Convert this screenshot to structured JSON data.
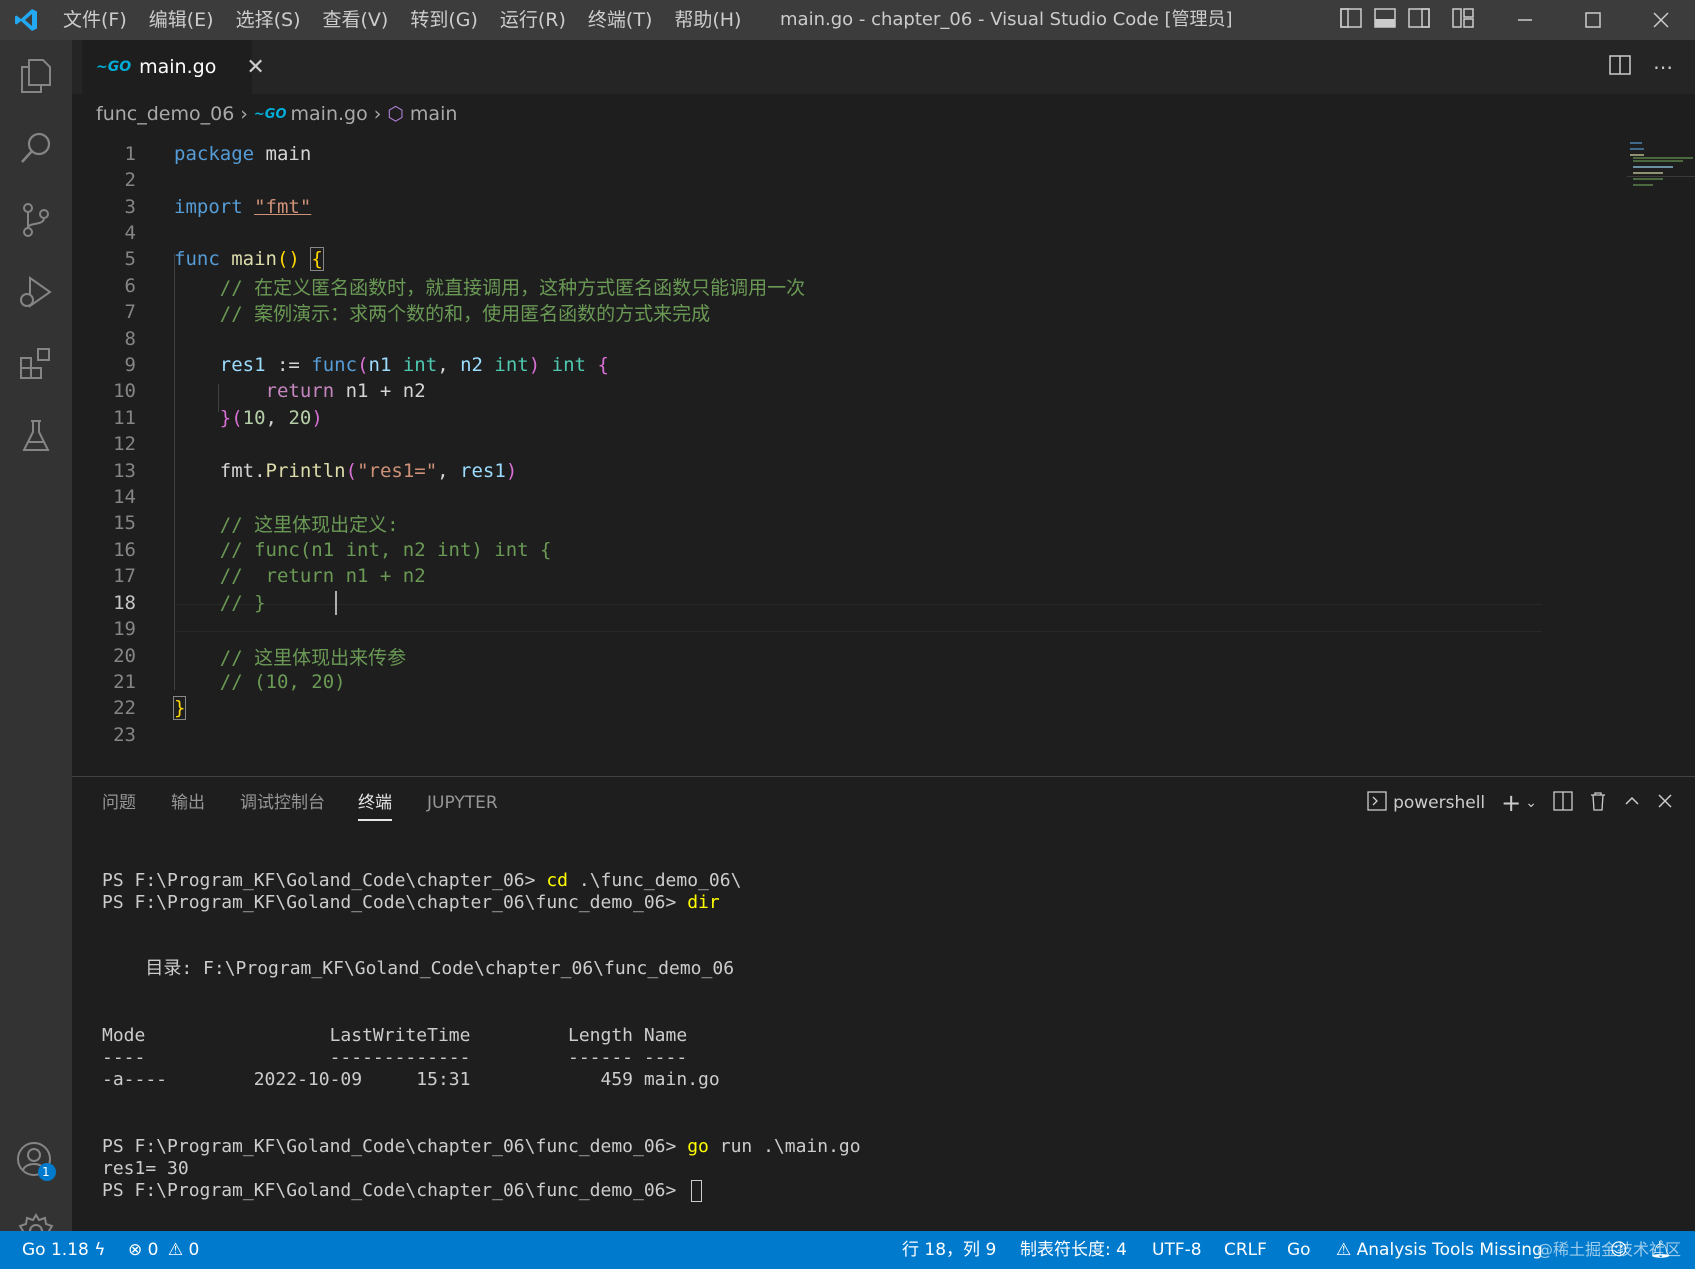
{
  "titlebar": {
    "menu": [
      "文件(F)",
      "编辑(E)",
      "选择(S)",
      "查看(V)",
      "转到(G)",
      "运行(R)",
      "终端(T)",
      "帮助(H)"
    ],
    "title": "main.go - chapter_06 - Visual Studio Code [管理员]"
  },
  "icons": {
    "activity": [
      "explorer-icon",
      "search-icon",
      "source-control-icon",
      "run-debug-icon",
      "extensions-icon",
      "testing-icon",
      "accounts-icon",
      "settings-gear-icon"
    ],
    "accounts_badge": "1"
  },
  "tab": {
    "label": "main.go",
    "close": "✕"
  },
  "breadcrumb": {
    "folder": "func_demo_06",
    "file": "main.go",
    "symbol": "main"
  },
  "editor": {
    "active_line": 18,
    "lines": [
      {
        "n": "1"
      },
      {
        "n": "2"
      },
      {
        "n": "3"
      },
      {
        "n": "4"
      },
      {
        "n": "5"
      },
      {
        "n": "6"
      },
      {
        "n": "7"
      },
      {
        "n": "8"
      },
      {
        "n": "9"
      },
      {
        "n": "10"
      },
      {
        "n": "11"
      },
      {
        "n": "12"
      },
      {
        "n": "13"
      },
      {
        "n": "14"
      },
      {
        "n": "15"
      },
      {
        "n": "16"
      },
      {
        "n": "17"
      },
      {
        "n": "18"
      },
      {
        "n": "19"
      },
      {
        "n": "20"
      },
      {
        "n": "21"
      },
      {
        "n": "22"
      },
      {
        "n": "23"
      }
    ],
    "code": {
      "l1_kw": "package",
      "l1_id": " main",
      "l3_kw": "import",
      "l3_str": "\"fmt\"",
      "l5_kw": "func",
      "l5_fn": "main",
      "l6_cm": "// 在定义匿名函数时，就直接调用，这种方式匿名函数只能调用一次",
      "l7_cm": "// 案例演示：求两个数的和，使用匿名函数的方式来完成",
      "l9_id": "res1",
      "l9_op": " := ",
      "l9_kw": "func",
      "l9_p1": "n1",
      "l9_t1": "int",
      "l9_p2": "n2",
      "l9_t2": "int",
      "l9_t3": "int",
      "l10_kw": "return",
      "l10_rest": " n1 + n2",
      "l11_n1": "10",
      "l11_n2": "20",
      "l13_pkg": "fmt",
      "l13_fn": "Println",
      "l13_str": "\"res1=\"",
      "l13_arg": "res1",
      "l15_cm": "// 这里体现出定义:",
      "l16_cm": "// func(n1 int, n2 int) int {",
      "l17_cm": "//  return n1 + n2",
      "l18_cm": "// }",
      "l20_cm": "// 这里体现出来传参",
      "l21_cm": "// (10, 20)"
    }
  },
  "panel": {
    "tabs": [
      "问题",
      "输出",
      "调试控制台",
      "终端",
      "JUPYTER"
    ],
    "active_tab": "终端",
    "shell": "powershell",
    "terminal": {
      "l1_prompt": "PS F:\\Program_KF\\Goland_Code\\chapter_06> ",
      "l1_cmd": "cd",
      "l1_rest": " .\\func_demo_06\\",
      "l2_prompt": "PS F:\\Program_KF\\Goland_Code\\chapter_06\\func_demo_06> ",
      "l2_cmd": "dir",
      "l3": "    目录: F:\\Program_KF\\Goland_Code\\chapter_06\\func_demo_06",
      "l4": "Mode                 LastWriteTime         Length Name",
      "l5": "----                 -------------         ------ ----",
      "l6": "-a----        2022-10-09     15:31            459 main.go",
      "l7_prompt": "PS F:\\Program_KF\\Goland_Code\\chapter_06\\func_demo_06> ",
      "l7_cmd": "go",
      "l7_rest": " run .\\main.go",
      "l8": "res1= 30",
      "l9_prompt": "PS F:\\Program_KF\\Goland_Code\\chapter_06\\func_demo_06> "
    }
  },
  "statusbar": {
    "go_version": "Go 1.18",
    "errors": "0",
    "warnings": "0",
    "position": "行 18，列 9",
    "tab_size": "制表符长度: 4",
    "encoding": "UTF-8",
    "eol": "CRLF",
    "language": "Go",
    "analysis": "Analysis Tools Missing",
    "watermark": "@稀土掘金技术社区"
  },
  "colors": {
    "statusbar": "#007acc",
    "titlebar": "#3c3c3c",
    "activitybar": "#333333",
    "editor": "#1e1e1e"
  }
}
